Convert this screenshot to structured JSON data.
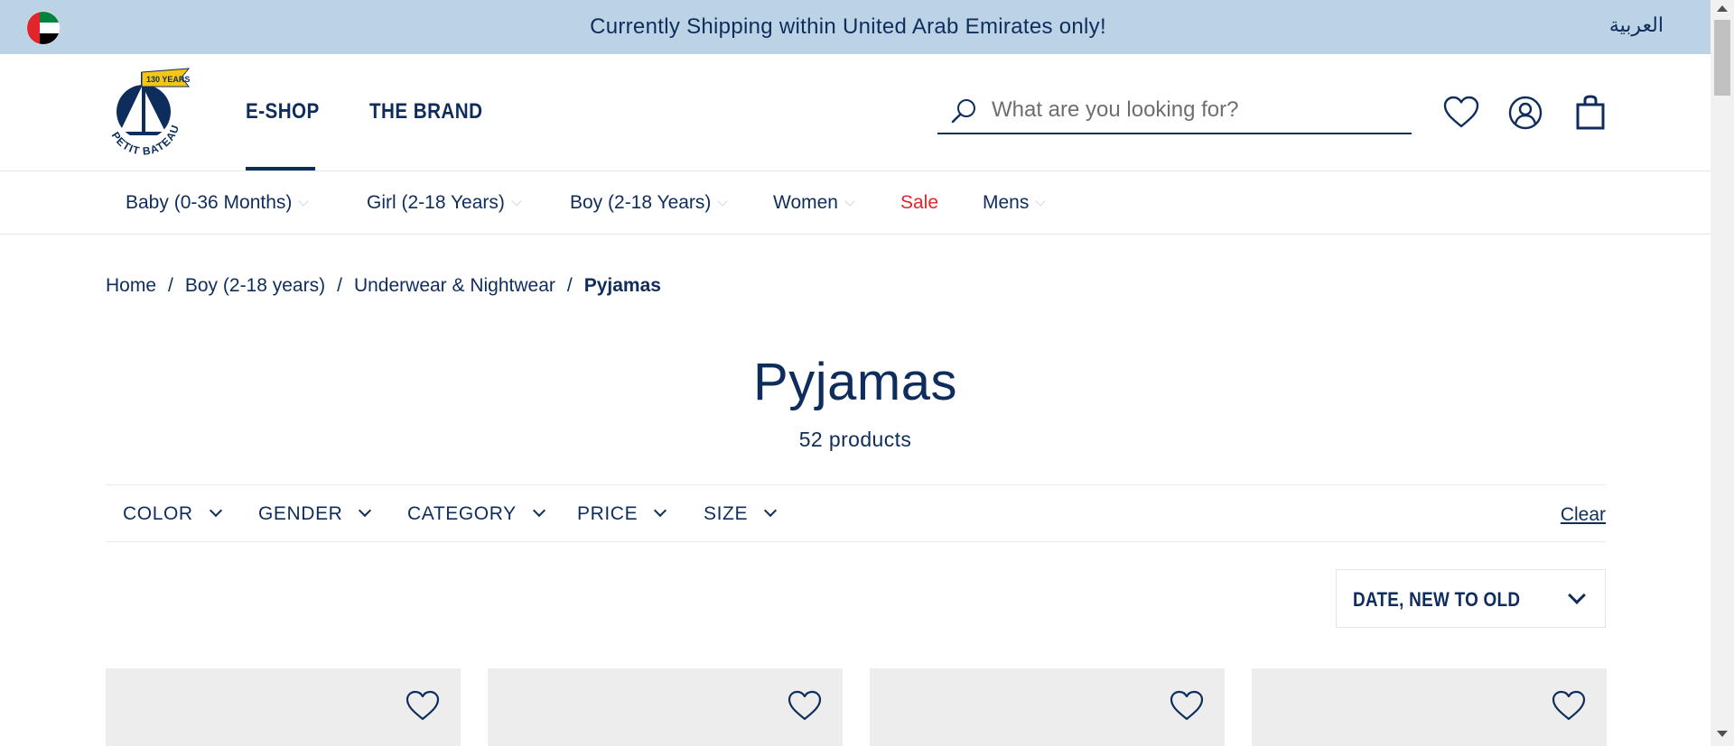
{
  "announcement": {
    "text": "Currently Shipping within United Arab Emirates only!",
    "language_switch": "العربية",
    "flag_icon": "uae-flag-icon"
  },
  "header": {
    "logo_text": "PETIT BATEAU",
    "logo_badge": "130 YEARS",
    "nav": [
      {
        "label": "E-SHOP",
        "active": true
      },
      {
        "label": "THE BRAND",
        "active": false
      }
    ],
    "search": {
      "placeholder": "What are you looking for?",
      "value": ""
    },
    "icons": [
      "heart-icon",
      "account-icon",
      "bag-icon"
    ]
  },
  "categories": [
    {
      "label": "Baby (0-36 Months)"
    },
    {
      "label": "Girl (2-18 Years)"
    },
    {
      "label": "Boy (2-18 Years)"
    },
    {
      "label": "Women"
    },
    {
      "label": "Sale"
    },
    {
      "label": "Mens"
    }
  ],
  "breadcrumb": {
    "items": [
      "Home",
      "Boy (2-18 years)",
      "Underwear & Nightwear"
    ],
    "current": "Pyjamas",
    "separator": "/"
  },
  "page": {
    "title": "Pyjamas",
    "count": "52 products"
  },
  "filters": {
    "items": [
      "COLOR",
      "GENDER",
      "CATEGORY",
      "PRICE",
      "SIZE"
    ],
    "clear": "Clear"
  },
  "sort": {
    "selected": "DATE, NEW TO OLD"
  },
  "colors": {
    "navy": "#0f2d5c",
    "announce_bg": "#bcd3e6",
    "sale_red": "#e2242c",
    "card_bg": "#eeedee",
    "logo_yellow": "#f5c518"
  }
}
